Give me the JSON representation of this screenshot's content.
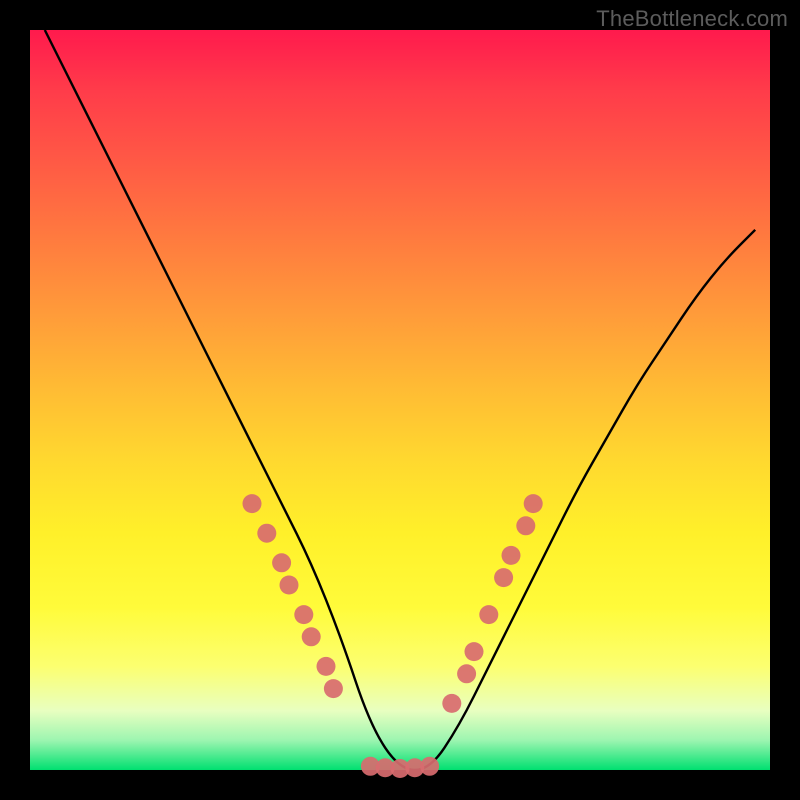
{
  "watermark": "TheBottleneck.com",
  "colors": {
    "background": "#000000",
    "curve_stroke": "#000000",
    "marker_fill": "#d86b6f",
    "marker_stroke": "#d86b6f"
  },
  "chart_data": {
    "type": "line",
    "title": "",
    "xlabel": "",
    "ylabel": "",
    "xlim": [
      0,
      100
    ],
    "ylim": [
      0,
      100
    ],
    "note": "V-shaped bottleneck curve. x is a normalized component-balance axis; y is relative bottleneck percentage. Minimum (0% bottleneck) occurs roughly over x≈46–54. Values estimated from pixel positions; axes have no printed tick labels.",
    "series": [
      {
        "name": "bottleneck-curve",
        "x": [
          2,
          6,
          10,
          14,
          18,
          22,
          26,
          30,
          34,
          38,
          42,
          46,
          50,
          54,
          58,
          62,
          66,
          70,
          74,
          78,
          82,
          86,
          90,
          94,
          98
        ],
        "y": [
          100,
          92,
          84,
          76,
          68,
          60,
          52,
          44,
          36,
          28,
          18,
          6,
          0,
          0,
          6,
          14,
          22,
          30,
          38,
          45,
          52,
          58,
          64,
          69,
          73
        ]
      },
      {
        "name": "left-markers",
        "type": "scatter",
        "x": [
          30,
          32,
          34,
          35,
          37,
          38,
          40,
          41
        ],
        "y": [
          36,
          32,
          28,
          25,
          21,
          18,
          14,
          11
        ]
      },
      {
        "name": "valley-markers",
        "type": "scatter",
        "x": [
          46,
          48,
          50,
          52,
          54
        ],
        "y": [
          0.5,
          0.3,
          0.2,
          0.3,
          0.5
        ]
      },
      {
        "name": "right-markers",
        "type": "scatter",
        "x": [
          57,
          59,
          60,
          62,
          64,
          65,
          67,
          68
        ],
        "y": [
          9,
          13,
          16,
          21,
          26,
          29,
          33,
          36
        ]
      }
    ]
  }
}
